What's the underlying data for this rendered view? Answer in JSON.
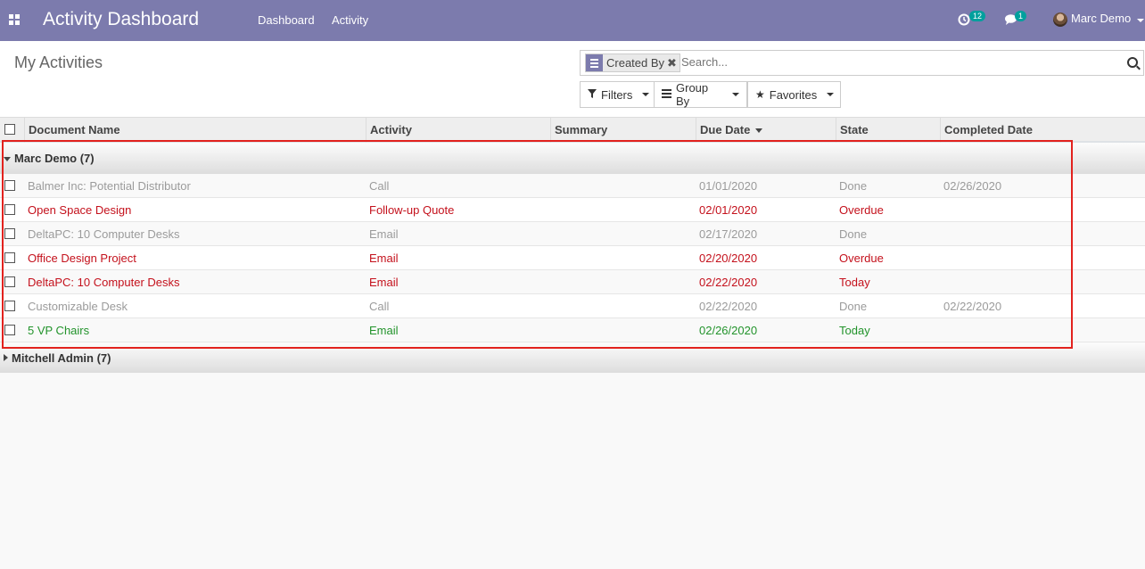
{
  "navbar": {
    "title": "Activity Dashboard",
    "menu": [
      "Dashboard",
      "Activity"
    ],
    "activity_count": "12",
    "message_count": "1",
    "user_name": "Marc Demo",
    "color": "#7c7bad"
  },
  "control": {
    "page_title": "My Activities",
    "facet_label": "Created By",
    "search_placeholder": "Search...",
    "filters_label": "Filters",
    "groupby_label": "Group By",
    "favorites_label": "Favorites"
  },
  "table": {
    "columns": [
      "Document Name",
      "Activity",
      "Summary",
      "Due Date",
      "State",
      "Completed Date"
    ],
    "groups": [
      {
        "label": "Marc Demo (7)",
        "expanded": true,
        "rows": [
          {
            "document": "Balmer Inc: Potential Distributor",
            "activity": "Call",
            "summary": "",
            "due": "01/01/2020",
            "state": "Done",
            "completed": "02/26/2020",
            "status": "done"
          },
          {
            "document": "Open Space Design",
            "activity": "Follow-up Quote",
            "summary": "",
            "due": "02/01/2020",
            "state": "Overdue",
            "completed": "",
            "status": "overdue"
          },
          {
            "document": "DeltaPC: 10 Computer Desks",
            "activity": "Email",
            "summary": "",
            "due": "02/17/2020",
            "state": "Done",
            "completed": "",
            "status": "done"
          },
          {
            "document": "Office Design Project",
            "activity": "Email",
            "summary": "",
            "due": "02/20/2020",
            "state": "Overdue",
            "completed": "",
            "status": "overdue"
          },
          {
            "document": "DeltaPC: 10 Computer Desks",
            "activity": "Email",
            "summary": "",
            "due": "02/22/2020",
            "state": "Today",
            "completed": "",
            "status": "overdue"
          },
          {
            "document": "Customizable Desk",
            "activity": "Call",
            "summary": "",
            "due": "02/22/2020",
            "state": "Done",
            "completed": "02/22/2020",
            "status": "done"
          },
          {
            "document": "5 VP Chairs",
            "activity": "Email",
            "summary": "",
            "due": "02/26/2020",
            "state": "Today",
            "completed": "",
            "status": "today"
          }
        ]
      },
      {
        "label": "Mitchell Admin (7)",
        "expanded": false,
        "rows": []
      }
    ]
  },
  "colors": {
    "done": "#9b9b9b",
    "overdue": "#c4111c",
    "today": "#22932b",
    "highlight": "#e2221e"
  }
}
